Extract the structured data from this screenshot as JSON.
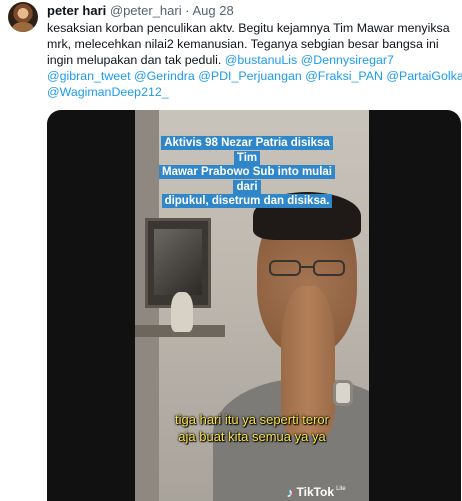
{
  "tweet": {
    "author_name": "peter hari",
    "author_handle": "@peter_hari",
    "separator": "·",
    "date": "Aug 28",
    "text_lines": [
      [
        {
          "t": "kesaksian korban penculikan aktv. Begitu kejamnya Tim Mawar menyiksa",
          "m": false
        }
      ],
      [
        {
          "t": "mrk, melecehkan nilai2 kemanusian. Teganya sebgian besar bangsa ini",
          "m": false
        }
      ],
      [
        {
          "t": "ingin melupakan dan tak peduli. ",
          "m": false
        },
        {
          "t": "@bustanuLis",
          "m": true
        },
        {
          "t": "  ",
          "m": false
        },
        {
          "t": "@Dennysiregar7",
          "m": true
        }
      ],
      [
        {
          "t": "@gibran_tweet",
          "m": true
        },
        {
          "t": " ",
          "m": false
        },
        {
          "t": "@Gerindra",
          "m": true
        },
        {
          "t": " ",
          "m": false
        },
        {
          "t": "@PDI_Perjuangan",
          "m": true
        },
        {
          "t": " ",
          "m": false
        },
        {
          "t": "@Fraksi_PAN",
          "m": true
        },
        {
          "t": " ",
          "m": false
        },
        {
          "t": "@PartaiGolkar",
          "m": true
        }
      ],
      [
        {
          "t": "@WagimanDeep212_",
          "m": true
        }
      ]
    ]
  },
  "media": {
    "caption_top_lines": [
      "Aktivis 98 Nezar Patria disiksa Tim",
      "Mawar Prabowo Sub into mulai dari",
      "dipukul, disetrum dan disiksa."
    ],
    "subtitle_lines": [
      "tiga hari itu ya seperti teror",
      "aja buat kita semua ya ya"
    ],
    "watermark": "TikTok",
    "watermark_suffix": "Lite"
  },
  "colors": {
    "mention": "#1d9bf0",
    "caption_bg": "#2f86c9",
    "subtitle": "#f5e04a"
  }
}
